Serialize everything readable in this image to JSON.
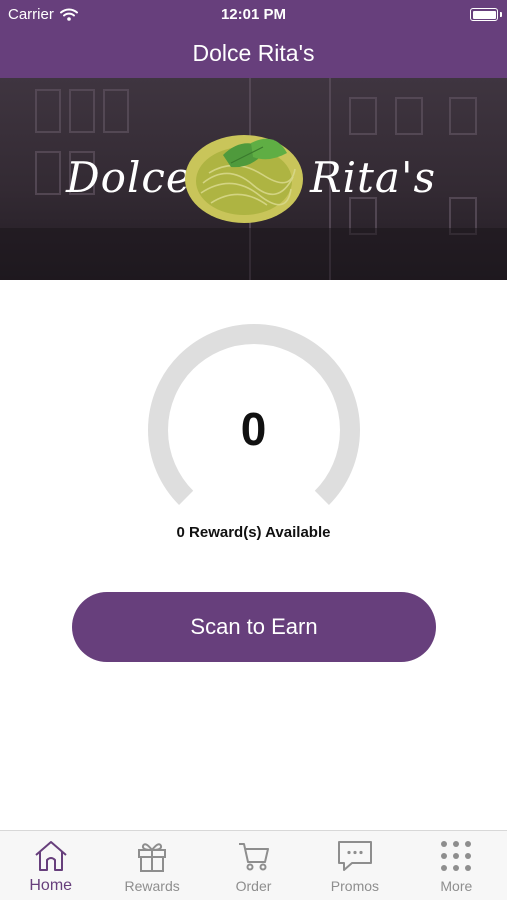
{
  "status_bar": {
    "carrier": "Carrier",
    "time": "12:01 PM"
  },
  "nav": {
    "title": "Dolce Rita's"
  },
  "banner": {
    "logo_left": "Dolce",
    "logo_right": "Rita's"
  },
  "rewards": {
    "points": "0",
    "available_label": "0 Reward(s) Available",
    "progress_fraction": 0
  },
  "actions": {
    "scan_label": "Scan to Earn"
  },
  "tab_bar": {
    "items": [
      {
        "label": "Home",
        "icon": "home-icon",
        "active": true
      },
      {
        "label": "Rewards",
        "icon": "gift-icon",
        "active": false
      },
      {
        "label": "Order",
        "icon": "cart-icon",
        "active": false
      },
      {
        "label": "Promos",
        "icon": "chat-bubble-icon",
        "active": false
      },
      {
        "label": "More",
        "icon": "grid-dots-icon",
        "active": false
      }
    ]
  },
  "colors": {
    "brand": "#673f7c",
    "gauge_track": "#dedede",
    "tab_inactive": "#8e8e8e"
  }
}
